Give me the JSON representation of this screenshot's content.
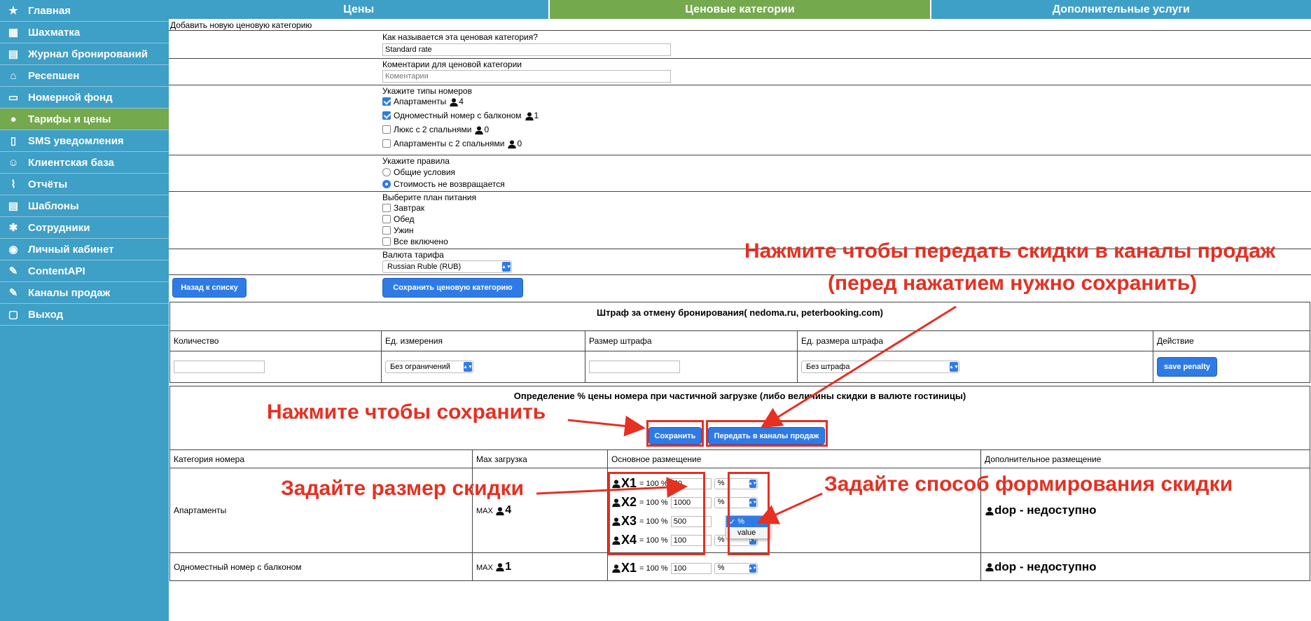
{
  "sidebar": {
    "items": [
      {
        "label": "Главная",
        "icon": "star-icon"
      },
      {
        "label": "Шахматка",
        "icon": "grid-icon"
      },
      {
        "label": "Журнал бронирований",
        "icon": "book-icon"
      },
      {
        "label": "Ресепшен",
        "icon": "reception-icon"
      },
      {
        "label": "Номерной фонд",
        "icon": "bed-icon"
      },
      {
        "label": "Тарифы и цены",
        "icon": "money-bag-icon",
        "active": true
      },
      {
        "label": "SMS уведомления",
        "icon": "phone-icon"
      },
      {
        "label": "Клиентская база",
        "icon": "client-icon"
      },
      {
        "label": "Отчёты",
        "icon": "chart-icon"
      },
      {
        "label": "Шаблоны",
        "icon": "template-icon"
      },
      {
        "label": "Сотрудники",
        "icon": "gear-icon"
      },
      {
        "label": "Личный кабинет",
        "icon": "user-icon"
      },
      {
        "label": "ContentAPI",
        "icon": "api-icon"
      },
      {
        "label": "Каналы продаж",
        "icon": "channels-icon"
      },
      {
        "label": "Выход",
        "icon": "exit-icon"
      }
    ]
  },
  "tabs": [
    {
      "label": "Цены"
    },
    {
      "label": "Ценовые категории",
      "active": true
    },
    {
      "label": "Дополнительные услуги"
    }
  ],
  "form": {
    "heading": "Добавить новую ценовую категорию",
    "name_label": "Как называется эта ценовая категория?",
    "name_value": "Standard rate",
    "comment_label": "Коментарии для ценовой категории",
    "comment_placeholder": "Коментарии",
    "room_types_label": "Укажите типы номеров",
    "room_types": [
      {
        "label": "Апартаменты",
        "count": "4",
        "checked": true
      },
      {
        "label": "Одноместный номер с балконом",
        "count": "1",
        "checked": true
      },
      {
        "label": "Люкс с 2 спальнями",
        "count": "0",
        "checked": false
      },
      {
        "label": "Апартаменты с 2 спальнями",
        "count": "0",
        "checked": false
      }
    ],
    "rules_label": "Укажите правила",
    "rules": [
      {
        "label": "Общие условия",
        "checked": false
      },
      {
        "label": "Стоимость не возвращается",
        "checked": true
      }
    ],
    "meal_label": "Выберите план питания",
    "meals": [
      {
        "label": "Завтрак"
      },
      {
        "label": "Обед"
      },
      {
        "label": "Ужин"
      },
      {
        "label": "Все включено"
      }
    ],
    "currency_label": "Валюта тарифа",
    "currency_value": "Russian Ruble (RUB)",
    "back_button": "Назад к списку",
    "save_button": "Сохранить ценовую категорию"
  },
  "penalty": {
    "title": "Штраф за отмену бронирования( nedoma.ru, peterbooking.com)",
    "headers": [
      "Количество",
      "Ед. измерения",
      "Размер штрафа",
      "Ед. размера штрафа",
      "Действие"
    ],
    "unit_value": "Без ограничений",
    "penalty_unit_value": "Без штрафа",
    "save_button": "save penalty"
  },
  "occupancy": {
    "title": "Определение % цены номера при частичной загрузке (либо величины скидки в валюте гостиницы)",
    "save_button": "Сохранить",
    "channels_button": "Передать в каналы продаж",
    "headers": [
      "Категория номера",
      "Max загрузка",
      "Основное размещение",
      "Дополнительное размещение"
    ],
    "eq_text": "= 100 %",
    "max_text": "MAX",
    "rows": [
      {
        "category": "Апартаменты",
        "max": "4",
        "extra": "dop - недоступно",
        "lines": [
          {
            "x": "X1",
            "value": "70",
            "unit": "%"
          },
          {
            "x": "X2",
            "value": "1000",
            "unit": "%"
          },
          {
            "x": "X3",
            "value": "500",
            "unit": ""
          },
          {
            "x": "X4",
            "value": "100",
            "unit": "%"
          }
        ]
      },
      {
        "category": "Одноместный номер с балконом",
        "max": "1",
        "extra": "dop - недоступно",
        "lines": [
          {
            "x": "X1",
            "value": "100",
            "unit": "%"
          }
        ]
      }
    ],
    "dropdown_options": [
      "%",
      "value"
    ]
  },
  "annotations": {
    "channels_hint_1": "Нажмите чтобы передать скидки в каналы продаж",
    "channels_hint_2": "(перед нажатием нужно сохранить)",
    "save_hint": "Нажмите чтобы сохранить",
    "size_hint": "Задайте размер скидки",
    "method_hint": "Задайте способ формирования скидки",
    "color": "#e53022"
  },
  "colors": {
    "sidebar": "#3e9fc7",
    "active": "#74a94d",
    "button": "#2f7be6"
  }
}
